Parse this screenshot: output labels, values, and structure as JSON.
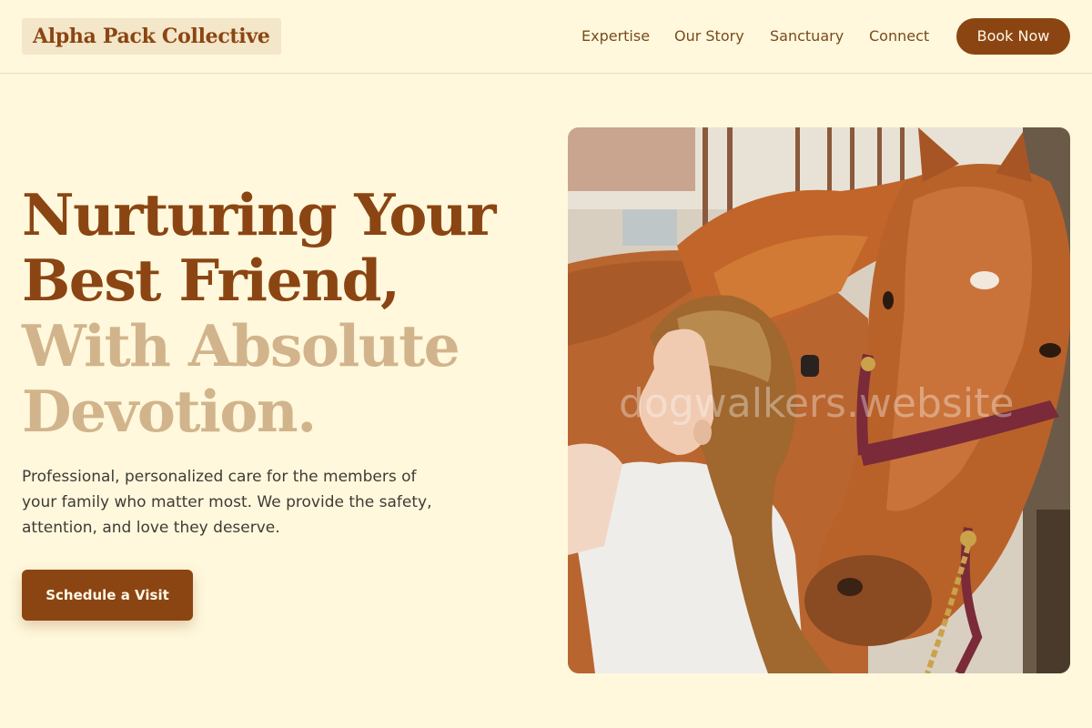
{
  "header": {
    "logo": "Alpha Pack Collective",
    "nav": [
      "Expertise",
      "Our Story",
      "Sanctuary",
      "Connect"
    ],
    "book_label": "Book Now"
  },
  "hero": {
    "headline_dark_1": "Nurturing Your",
    "headline_dark_2": "Best Friend,",
    "headline_light_1": "With Absolute",
    "headline_light_2": "Devotion.",
    "subtext": "Professional, personalized care for the members of your family who matter most. We provide the safety, attention, and love they deserve.",
    "cta_label": "Schedule a Visit",
    "image_watermark": "dogwalkers.website"
  },
  "colors": {
    "background": "#fff8dc",
    "brand": "#8b4513",
    "accent_light": "#d2b48c",
    "text": "#3f3a36"
  }
}
